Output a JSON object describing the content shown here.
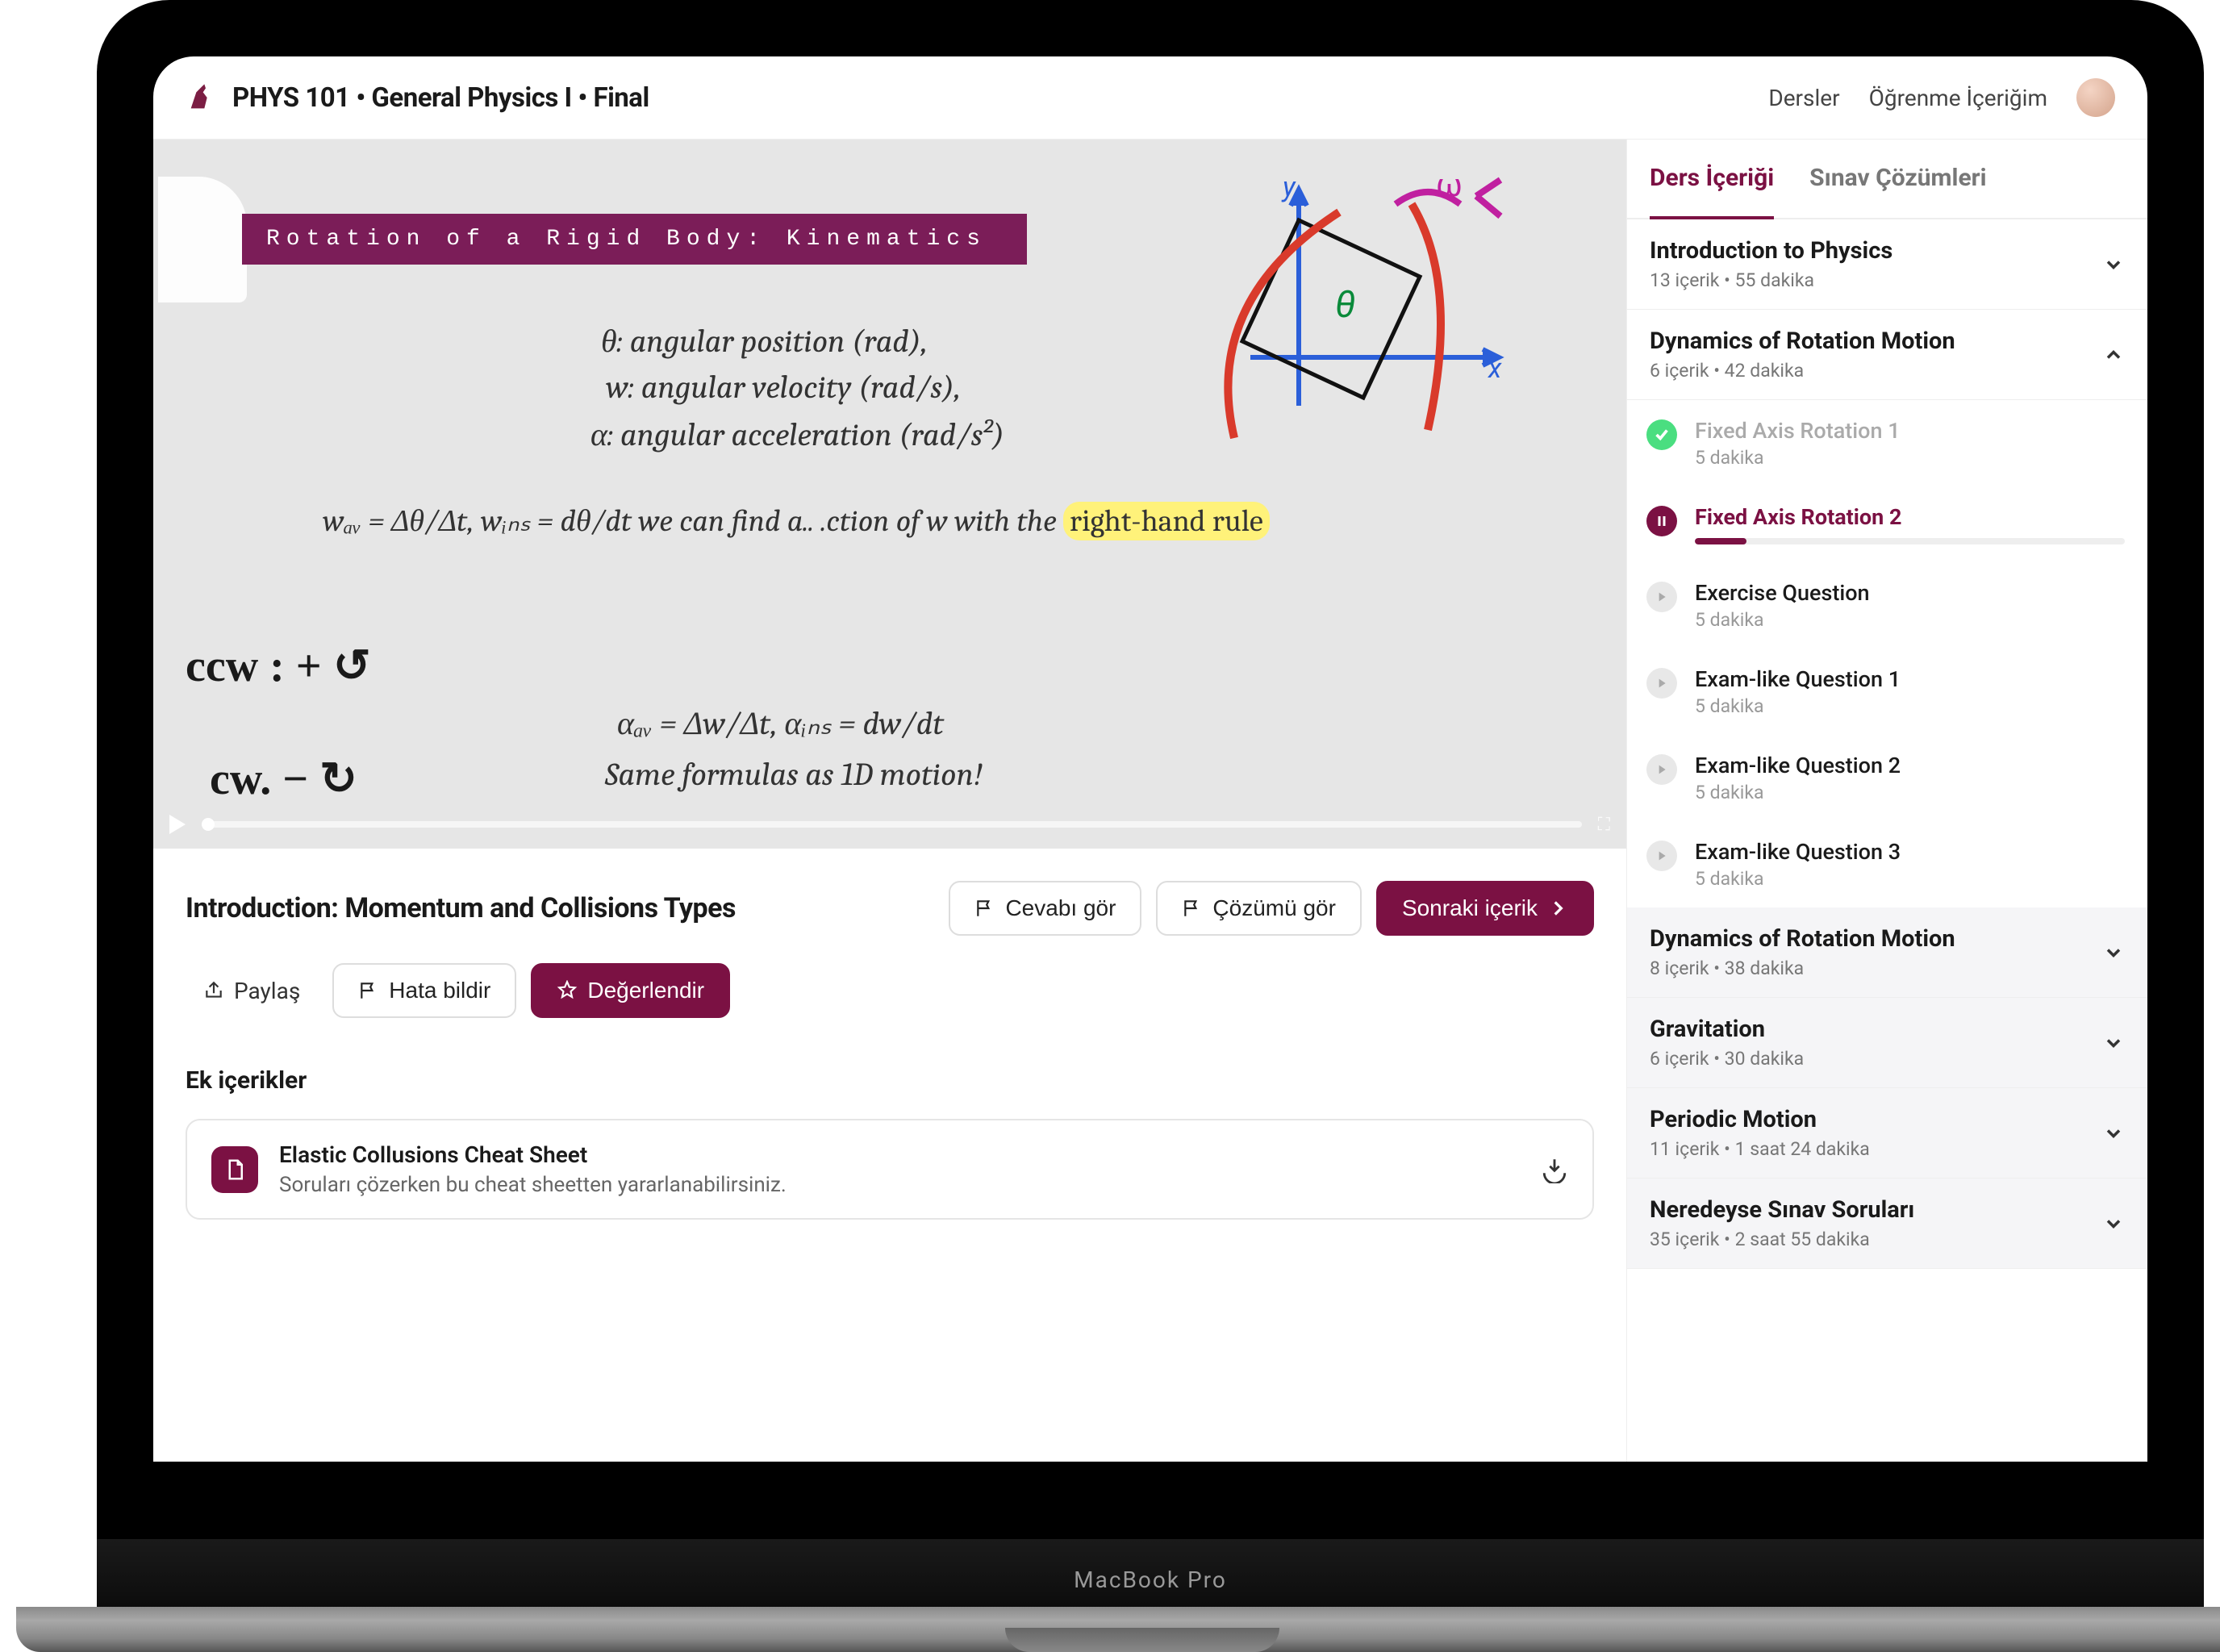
{
  "header": {
    "title": "PHYS 101 • General Physics I • Final",
    "nav": {
      "courses": "Dersler",
      "learning": "Öğrenme İçeriğim"
    }
  },
  "laptop_label": "MacBook Pro",
  "video": {
    "slide_title": "Rotation of a Rigid Body: Kinematics",
    "eq1": "θ: angular position (rad),",
    "eq2": "w: angular velocity (rad/s),",
    "eq3": "α: angular acceleration (rad/s²)",
    "eq4_prefix": "wₐᵥ = Δθ/Δt,    wᵢₙₛ = dθ/dt   we can find         a..  .ction of w with the ",
    "eq4_highlight": "right-hand rule",
    "eq5": "αₐᵥ = Δw/Δt,     αᵢₙₛ = dw/dt",
    "eq6": "Same formulas as 1D motion!",
    "hand1": "ccw : +  ↺",
    "hand2": "cw.   −   ↻",
    "axis_x": "x",
    "axis_y": "y"
  },
  "below": {
    "lesson_title": "Introduction: Momentum and Collisions Types",
    "show_answer": "Cevabı gör",
    "show_solution": "Çözümü gör",
    "next_content": "Sonraki içerik",
    "share": "Paylaş",
    "report": "Hata bildir",
    "rate": "Değerlendir",
    "extras_heading": "Ek içerikler",
    "attachment": {
      "title": "Elastic Collusions Cheat Sheet",
      "desc": "Soruları çözerken bu cheat sheetten yararlanabilirsiniz."
    }
  },
  "sidebar": {
    "tabs": {
      "content": "Ders İçeriği",
      "solutions": "Sınav Çözümleri"
    },
    "sections": [
      {
        "title": "Introduction to Physics",
        "meta": "13 içerik • 55 dakika",
        "expanded": false,
        "plain": true
      },
      {
        "title": "Dynamics of Rotation Motion",
        "meta": "6 içerik • 42 dakika",
        "expanded": true,
        "plain": true,
        "lessons": [
          {
            "name": "Fixed Axis Rotation 1",
            "dur": "5 dakika",
            "state": "done"
          },
          {
            "name": "Fixed Axis Rotation 2",
            "dur": "",
            "state": "current"
          },
          {
            "name": "Exercise Question",
            "dur": "5 dakika",
            "state": "pending"
          },
          {
            "name": "Exam-like Question 1",
            "dur": "5 dakika",
            "state": "pending"
          },
          {
            "name": "Exam-like Question 2",
            "dur": "5 dakika",
            "state": "pending"
          },
          {
            "name": "Exam-like Question 3",
            "dur": "5 dakika",
            "state": "pending"
          }
        ]
      },
      {
        "title": "Dynamics of Rotation Motion",
        "meta": "8 içerik • 38 dakika",
        "expanded": false
      },
      {
        "title": "Gravitation",
        "meta": "6 içerik • 30 dakika",
        "expanded": false
      },
      {
        "title": "Periodic Motion",
        "meta": "11 içerik • 1 saat 24 dakika",
        "expanded": false
      },
      {
        "title": "Neredeyse Sınav Soruları",
        "meta": "35 içerik • 2 saat 55 dakika",
        "expanded": false
      }
    ]
  }
}
